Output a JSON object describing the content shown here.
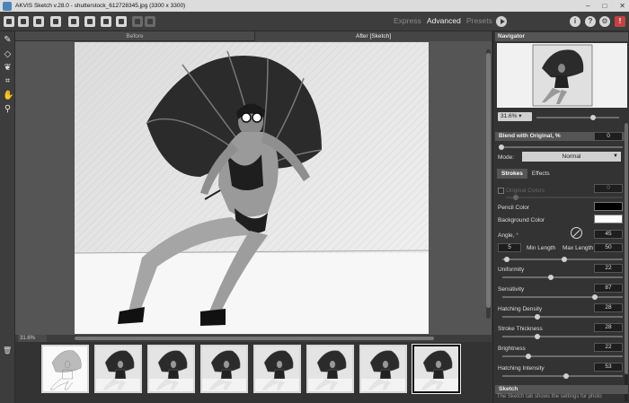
{
  "window": {
    "title": "AKVIS Sketch v.28.0 - shutterstock_612728345.jpg (3300 x 3300)",
    "controls": [
      "–",
      "□",
      "✕"
    ]
  },
  "toolbar": {
    "modes": {
      "express": "Express",
      "advanced": "Advanced",
      "presets": "Presets"
    },
    "help_icons": {
      "info": "i",
      "help": "?",
      "settings": "⚙",
      "quit": "!"
    }
  },
  "view": {
    "before_tab": "Before",
    "after_tab": "After [Sketch]",
    "zoom": "31.6%"
  },
  "thumbnails": {
    "count": 8,
    "selected_index": 7
  },
  "navigator": {
    "title": "Navigator",
    "zoom": "31.6% ▾",
    "zoom_level": 0.7
  },
  "blend": {
    "title": "Blend with Original, %",
    "value": "0",
    "mode_label": "Mode:",
    "mode_value": "Normal"
  },
  "tabs": {
    "strokes": "Strokes",
    "effects": "Effects"
  },
  "strokes": {
    "original_colors": "Original Colors",
    "original_colors_value": "0",
    "pencil_color": "Pencil Color",
    "pencil_color_hex": "#000000",
    "background_color": "Background Color",
    "background_color_hex": "#ffffff",
    "angle_label": "Angle, °",
    "angle_value": "45",
    "min_length_value": "5",
    "min_length_label": "Min Length",
    "max_length_label": "Max Length",
    "max_length_value": "50",
    "params": [
      {
        "label": "Uniformity",
        "value": "22"
      },
      {
        "label": "Sensitivity",
        "value": "87"
      },
      {
        "label": "Hatching Density",
        "value": "28"
      },
      {
        "label": "Stroke Thickness",
        "value": "28"
      },
      {
        "label": "Brightness",
        "value": "22"
      },
      {
        "label": "Hatching Intensity",
        "value": "53"
      }
    ]
  },
  "sketch_section": {
    "title": "Sketch",
    "desc": "The Sketch tab shows the settings for photo"
  }
}
